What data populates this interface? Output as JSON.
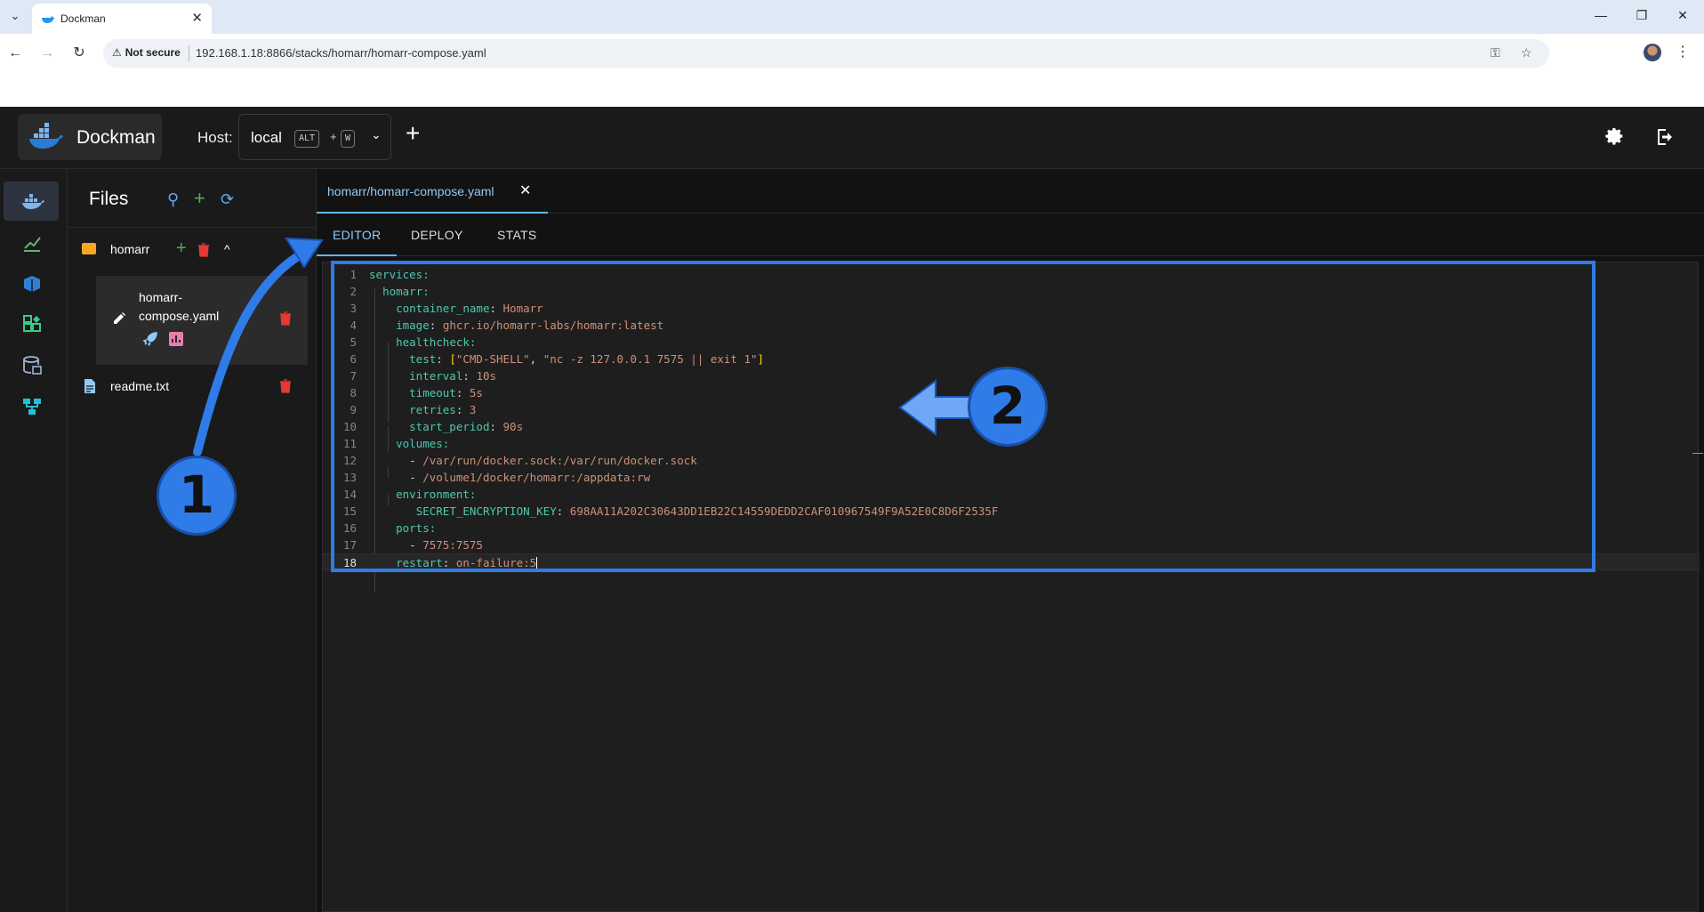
{
  "browser": {
    "tab_title": "Dockman",
    "security_label": "Not secure",
    "url": "192.168.1.18:8866/stacks/homarr/homarr-compose.yaml"
  },
  "app": {
    "brand": "Dockman",
    "host_label": "Host:",
    "host_value": "local",
    "shortcut_key1": "ALT",
    "shortcut_plus": "+",
    "shortcut_key2": "W"
  },
  "files": {
    "title": "Files",
    "folder": "homarr",
    "selected_file": "homarr-compose.yaml",
    "other_file": "readme.txt"
  },
  "editor": {
    "open_tab": "homarr/homarr-compose.yaml",
    "mode_tabs": [
      "EDITOR",
      "DEPLOY",
      "STATS"
    ],
    "line_numbers": [
      "1",
      "2",
      "3",
      "4",
      "5",
      "6",
      "7",
      "8",
      "9",
      "10",
      "11",
      "12",
      "13",
      "14",
      "15",
      "16",
      "17",
      "18"
    ]
  },
  "code": {
    "l1": "services:",
    "l2": "homarr:",
    "l3k": "container_name",
    "l3v": "Homarr",
    "l4k": "image",
    "l4v": "ghcr.io/homarr-labs/homarr:latest",
    "l5": "healthcheck:",
    "l6k": "test",
    "l6v1": "\"CMD-SHELL\"",
    "l6v2": "\"nc -z 127.0.0.1 7575 || exit 1\"",
    "l7k": "interval",
    "l7v": "10s",
    "l8k": "timeout",
    "l8v": "5s",
    "l9k": "retries",
    "l9v": "3",
    "l10k": "start_period",
    "l10v": "90s",
    "l11": "volumes:",
    "l12v": "/var/run/docker.sock:/var/run/docker.sock",
    "l13v": "/volume1/docker/homarr:/appdata:rw",
    "l14": "environment:",
    "l15k": "SECRET_ENCRYPTION_KEY",
    "l15v": "698AA11A202C30643DD1EB22C14559DEDD2CAF010967549F9A52E0C8D6F2535F",
    "l16": "ports:",
    "l17v": "7575:7575",
    "l18k": "restart",
    "l18v": "on-failure:5"
  },
  "annotations": {
    "badge1": "1",
    "badge2": "2",
    "color": "#2f7be8"
  }
}
